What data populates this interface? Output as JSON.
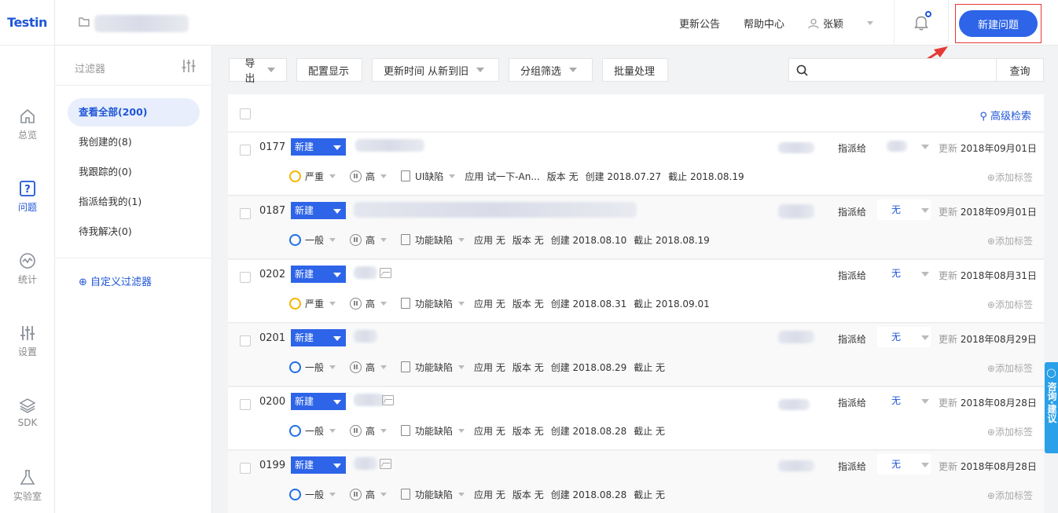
{
  "app": {
    "logo_text": "Testin"
  },
  "nav": [
    {
      "label": "总览",
      "icon": "home-icon"
    },
    {
      "label": "问题",
      "icon": "question-icon",
      "active": true
    },
    {
      "label": "统计",
      "icon": "stats-icon"
    },
    {
      "label": "设置",
      "icon": "settings-sliders-icon"
    },
    {
      "label": "SDK",
      "icon": "layers-icon"
    },
    {
      "label": "实验室",
      "icon": "flask-icon"
    }
  ],
  "header": {
    "announcement": "更新公告",
    "help": "帮助中心",
    "user": "张颖",
    "new_issue": "新建问题"
  },
  "filters": {
    "title": "过滤器",
    "items": [
      {
        "label": "查看全部(200)",
        "active": true
      },
      {
        "label": "我创建的(8)"
      },
      {
        "label": "我跟踪的(0)"
      },
      {
        "label": "指派给我的(1)"
      },
      {
        "label": "待我解决(0)"
      }
    ],
    "custom": "自定义过滤器"
  },
  "toolbar": {
    "export": "导出",
    "display": "配置显示",
    "sort": "更新时间 从新到旧",
    "group": "分组筛选",
    "batch": "批量处理",
    "search_placeholder": "",
    "query": "查询",
    "advanced": "高级检索"
  },
  "issues": [
    {
      "id": "0177",
      "status": "新建",
      "severity": "严重",
      "severity_color": "#f2b600",
      "priority": "高",
      "type": "UI缺陷",
      "app": "应用 试一下-An...",
      "version": "版本 无",
      "created": "创建 2018.07.27",
      "deadline": "截止 2018.08.19",
      "assign_label": "指派给",
      "assignee": "",
      "updated_label": "更新",
      "updated": "2018年09月01日",
      "add_tag": "添加标签"
    },
    {
      "id": "0187",
      "status": "新建",
      "severity": "一般",
      "severity_color": "#1f6fe5",
      "priority": "高",
      "type": "功能缺陷",
      "app": "应用 无",
      "version": "版本 无",
      "created": "创建 2018.08.10",
      "deadline": "截止 2018.08.19",
      "assign_label": "指派给",
      "assignee": "无",
      "updated_label": "更新",
      "updated": "2018年09月01日",
      "add_tag": "添加标签"
    },
    {
      "id": "0202",
      "status": "新建",
      "severity": "严重",
      "severity_color": "#f2b600",
      "priority": "高",
      "type": "功能缺陷",
      "app": "应用 无",
      "version": "版本 无",
      "created": "创建 2018.08.31",
      "deadline": "截止 2018.09.01",
      "assign_label": "指派给",
      "assignee": "无",
      "updated_label": "更新",
      "updated": "2018年08月31日",
      "add_tag": "添加标签"
    },
    {
      "id": "0201",
      "status": "新建",
      "severity": "一般",
      "severity_color": "#1f6fe5",
      "priority": "高",
      "type": "功能缺陷",
      "app": "应用 无",
      "version": "版本 无",
      "created": "创建 2018.08.29",
      "deadline": "截止 无",
      "assign_label": "指派给",
      "assignee": "无",
      "updated_label": "更新",
      "updated": "2018年08月29日",
      "add_tag": "添加标签"
    },
    {
      "id": "0200",
      "status": "新建",
      "severity": "一般",
      "severity_color": "#1f6fe5",
      "priority": "高",
      "type": "功能缺陷",
      "app": "应用 无",
      "version": "版本 无",
      "created": "创建 2018.08.28",
      "deadline": "截止 无",
      "assign_label": "指派给",
      "assignee": "无",
      "updated_label": "更新",
      "updated": "2018年08月28日",
      "add_tag": "添加标签"
    },
    {
      "id": "0199",
      "status": "新建",
      "severity": "一般",
      "severity_color": "#1f6fe5",
      "priority": "高",
      "type": "功能缺陷",
      "app": "应用 无",
      "version": "版本 无",
      "created": "创建 2018.08.28",
      "deadline": "截止 无",
      "assign_label": "指派给",
      "assignee": "无",
      "updated_label": "更新",
      "updated": "2018年08月28日",
      "add_tag": "添加标签"
    }
  ],
  "consult": {
    "label": "咨询·建议"
  },
  "colors": {
    "accent": "#2d64e8",
    "highlight_frame": "#e53935"
  }
}
